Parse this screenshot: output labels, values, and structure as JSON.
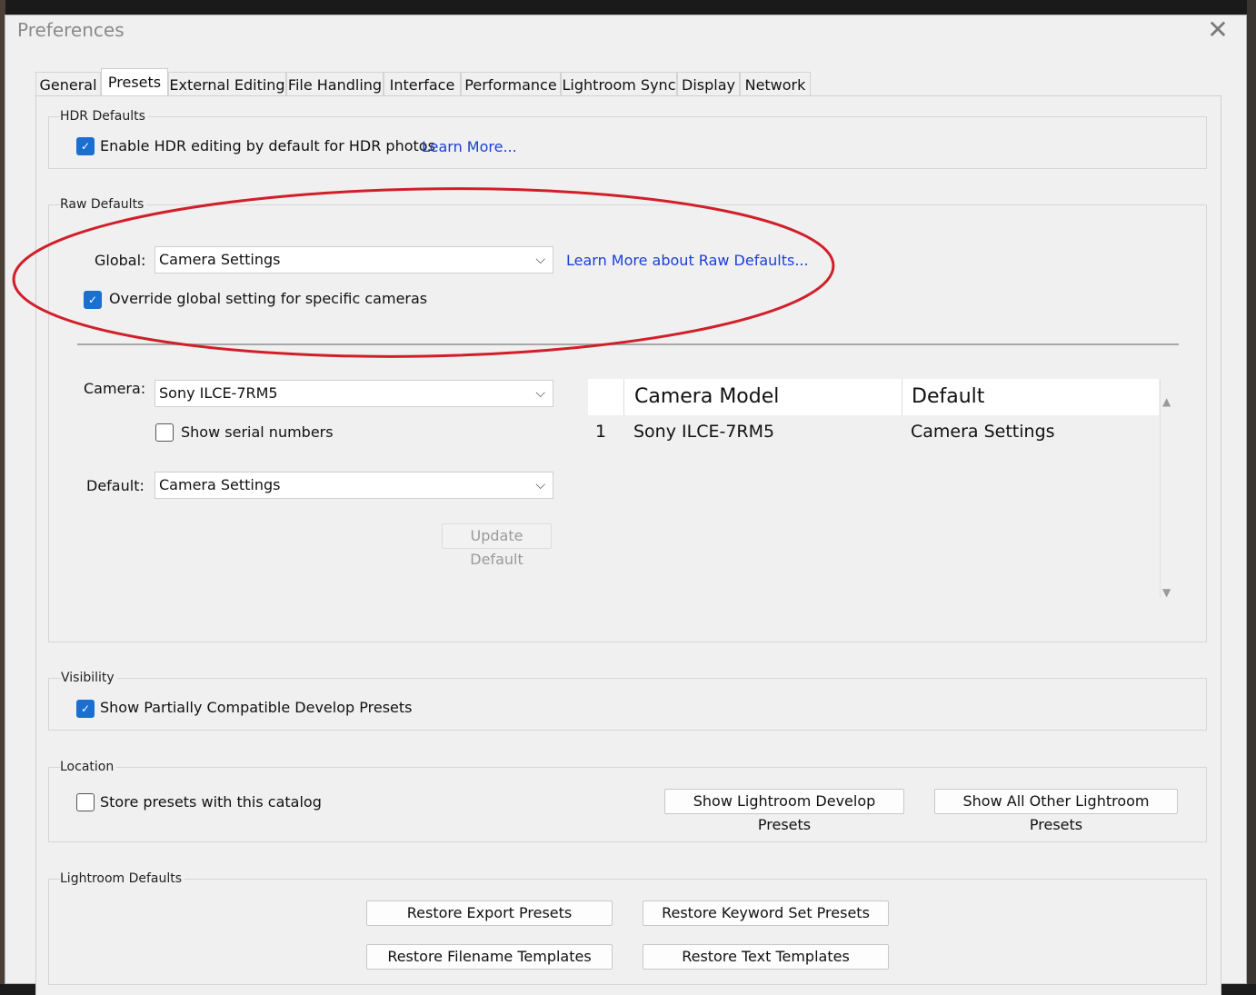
{
  "window": {
    "title": "Preferences"
  },
  "tabs": [
    {
      "label": "General"
    },
    {
      "label": "Presets"
    },
    {
      "label": "External Editing"
    },
    {
      "label": "File Handling"
    },
    {
      "label": "Interface"
    },
    {
      "label": "Performance"
    },
    {
      "label": "Lightroom Sync"
    },
    {
      "label": "Display"
    },
    {
      "label": "Network"
    }
  ],
  "active_tab": "Presets",
  "hdr": {
    "group_label": "HDR Defaults",
    "enable_label": "Enable HDR editing by default for HDR photos",
    "enable_checked": true,
    "learn_more": "Learn More..."
  },
  "raw": {
    "group_label": "Raw Defaults",
    "global_label": "Global:",
    "global_value": "Camera Settings",
    "learn_more": "Learn More about Raw Defaults...",
    "override_label": "Override global setting for specific cameras",
    "override_checked": true,
    "camera_label": "Camera:",
    "camera_value": "Sony ILCE-7RM5",
    "serial_label": "Show serial numbers",
    "serial_checked": false,
    "default_label": "Default:",
    "default_value": "Camera Settings",
    "update_button": "Update Default",
    "table": {
      "columns": [
        "Camera Model",
        "Default"
      ],
      "rows": [
        {
          "index": "1",
          "model": "Sony ILCE-7RM5",
          "default": "Camera Settings"
        }
      ]
    }
  },
  "visibility": {
    "group_label": "Visibility",
    "partial_label": "Show Partially Compatible Develop Presets",
    "partial_checked": true
  },
  "location": {
    "group_label": "Location",
    "store_label": "Store presets with this catalog",
    "store_checked": false,
    "show_develop": "Show Lightroom Develop Presets",
    "show_other": "Show All Other Lightroom Presets"
  },
  "lr_defaults": {
    "group_label": "Lightroom Defaults",
    "restore_export": "Restore Export Presets",
    "restore_keyword": "Restore Keyword Set Presets",
    "restore_filename": "Restore Filename Templates",
    "restore_text": "Restore Text Templates"
  },
  "icons": {
    "close": "close-icon",
    "checkmark": "check-icon",
    "chevron": "chevron-down-icon",
    "scroll_up": "scroll-up-icon",
    "scroll_down": "scroll-down-icon"
  },
  "colors": {
    "accent": "#1a6fd1",
    "link": "#1a3fd6",
    "annotation": "#d11f2a"
  }
}
